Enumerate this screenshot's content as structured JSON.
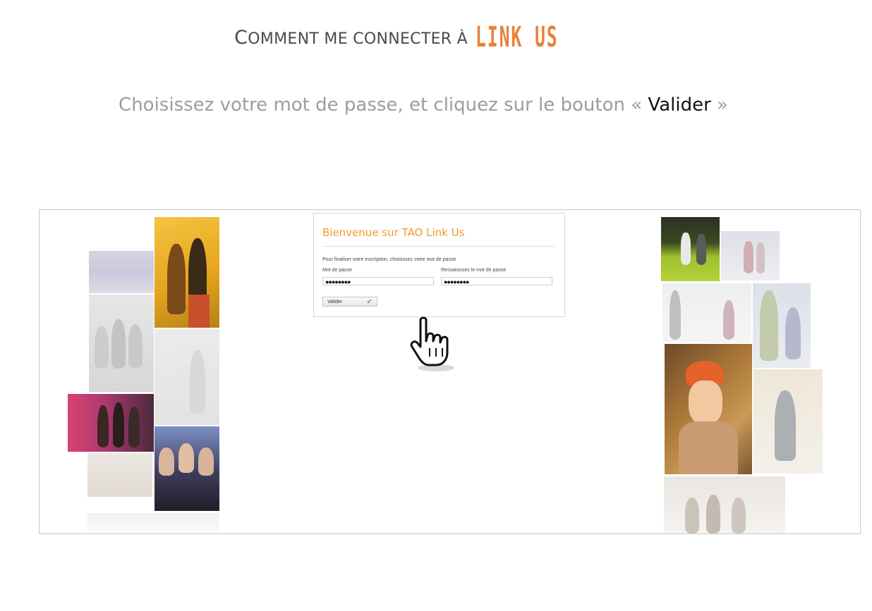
{
  "header": {
    "title_c": "C",
    "title_rest": "OMMENT ME CONNECTER À",
    "brand": "LINK US"
  },
  "instruction": {
    "before": "Choisissez votre mot de passe, et cliquez sur le bouton « ",
    "button_word": "Valider",
    "after": " »"
  },
  "form": {
    "title": "Bienvenue sur TAO Link Us",
    "intro": "Pour finaliser votre inscription, choisissez votre mot de passe",
    "password_label": "Mot de passe",
    "confirm_label": "Ressaisissez le mot de passe",
    "password_value": "●●●●●●●●",
    "confirm_value": "●●●●●●●●",
    "submit_label": "Valider"
  },
  "icons": {
    "cursor": "hand-pointer-icon",
    "check": "check-icon"
  },
  "colors": {
    "accent": "#f29a2e",
    "brand": "#e8823a"
  }
}
